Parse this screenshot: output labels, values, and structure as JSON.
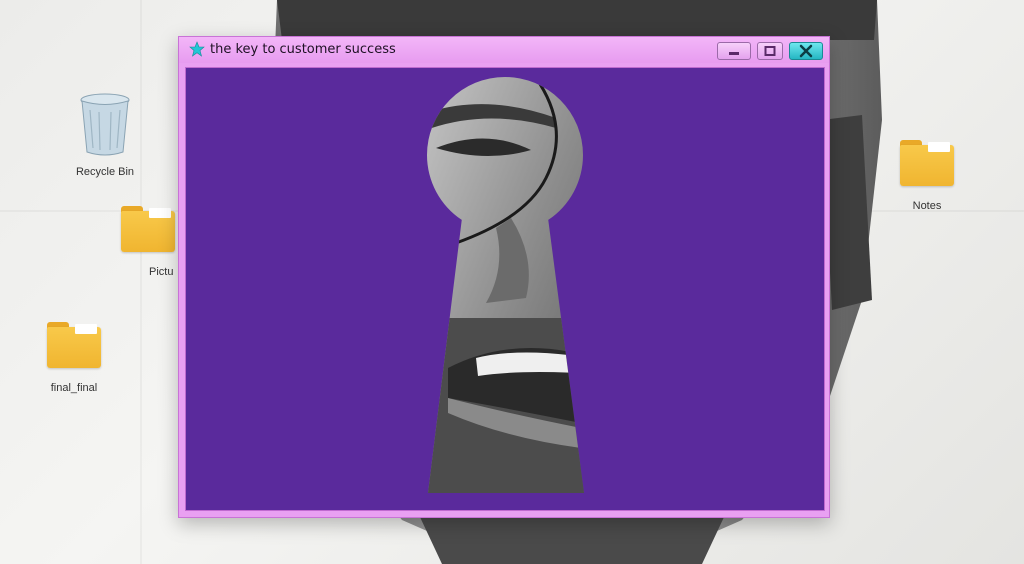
{
  "window": {
    "title": "the key to customer success"
  },
  "desktop_icons": [
    {
      "label": "Recycle Bin",
      "icon": "recycle-bin-icon"
    },
    {
      "label": "Pictu",
      "icon": "folder-icon"
    },
    {
      "label": "final_final",
      "icon": "folder-icon"
    },
    {
      "label": "Notes",
      "icon": "folder-icon"
    }
  ],
  "colors": {
    "window_frame": "#e9a0f2",
    "content_bg": "#5a2a9c",
    "close_button": "#25b6c3",
    "folder": "#f0b530"
  }
}
